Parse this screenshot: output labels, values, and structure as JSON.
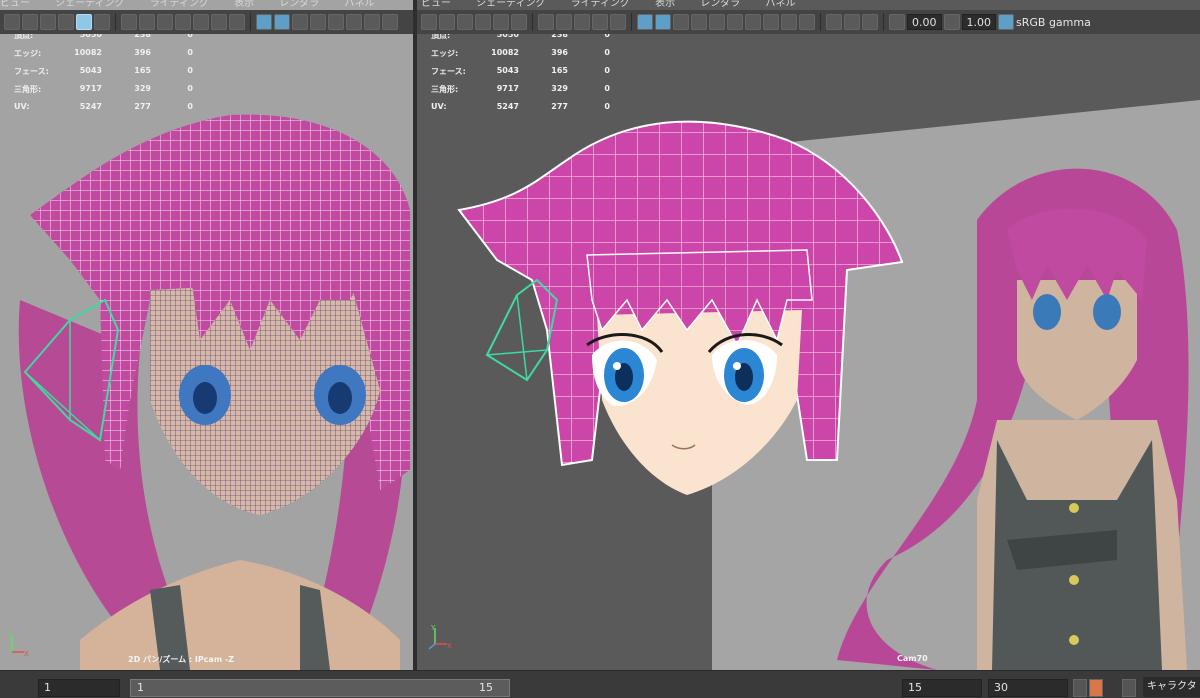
{
  "left_panel": {
    "menu": [
      "ビュー",
      "シェーディング",
      "ライティング",
      "表示",
      "レンダラ",
      "パネル"
    ],
    "hud": [
      {
        "label": "頂点:",
        "a": "5050",
        "b": "238",
        "c": "0"
      },
      {
        "label": "エッジ:",
        "a": "10082",
        "b": "396",
        "c": "0"
      },
      {
        "label": "フェース:",
        "a": "5043",
        "b": "165",
        "c": "0"
      },
      {
        "label": "三角形:",
        "a": "9717",
        "b": "329",
        "c": "0"
      },
      {
        "label": "UV:",
        "a": "5247",
        "b": "277",
        "c": "0"
      }
    ],
    "camera_label": "2D パン/ズーム : IPcam -Z"
  },
  "right_panel": {
    "menu": [
      "ビュー",
      "シェーディング",
      "ライティング",
      "表示",
      "レンダラ",
      "パネル"
    ],
    "hud": [
      {
        "label": "頂点:",
        "a": "5050",
        "b": "238",
        "c": "0"
      },
      {
        "label": "エッジ:",
        "a": "10082",
        "b": "396",
        "c": "0"
      },
      {
        "label": "フェース:",
        "a": "5043",
        "b": "165",
        "c": "0"
      },
      {
        "label": "三角形:",
        "a": "9717",
        "b": "329",
        "c": "0"
      },
      {
        "label": "UV:",
        "a": "5247",
        "b": "277",
        "c": "0"
      }
    ],
    "exposure": "0.00",
    "gamma": "1.00",
    "color_space": "sRGB gamma",
    "camera_label": "Cam70"
  },
  "timeline": {
    "current_frame": "1",
    "range_start": "1",
    "range_end": "15",
    "anim_end": "15",
    "playback_end": "30",
    "character_set": "キャラクタ セ"
  },
  "colors": {
    "hair": "#c8409f",
    "wire": "#ffffff",
    "selection": "#40d9a0",
    "accent": "#5d9fc6"
  }
}
